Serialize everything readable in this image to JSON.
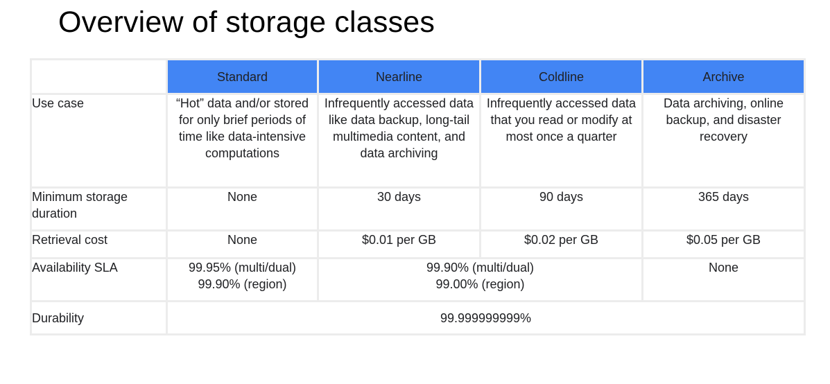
{
  "title": "Overview of storage classes",
  "columns": [
    "Standard",
    "Nearline",
    "Coldline",
    "Archive"
  ],
  "rows": {
    "use_case": {
      "label": "Use case",
      "standard": "“Hot” data and/or stored for only brief periods of time like data-intensive computations",
      "nearline": "Infrequently accessed data like data backup, long-tail multimedia content, and data archiving",
      "coldline": "Infrequently accessed data that you read or modify at most once a quarter",
      "archive": "Data archiving, online backup, and disaster recovery"
    },
    "min_storage": {
      "label": "Minimum storage duration",
      "standard": "None",
      "nearline": "30 days",
      "coldline": "90 days",
      "archive": "365 days"
    },
    "retrieval": {
      "label": "Retrieval cost",
      "standard": "None",
      "nearline": "$0.01 per GB",
      "coldline": "$0.02 per GB",
      "archive": "$0.05 per GB"
    },
    "availability": {
      "label": "Availability SLA",
      "standard_line1": "99.95% (multi/dual)",
      "standard_line2": "99.90% (region)",
      "nearline_coldline_line1": "99.90% (multi/dual)",
      "nearline_coldline_line2": "99.00% (region)",
      "archive": "None"
    },
    "durability": {
      "label": "Durability",
      "all": "99.999999999%"
    }
  },
  "colors": {
    "header_bg": "#4285f4",
    "header_text": "#ffffff",
    "grid": "#ececec"
  }
}
